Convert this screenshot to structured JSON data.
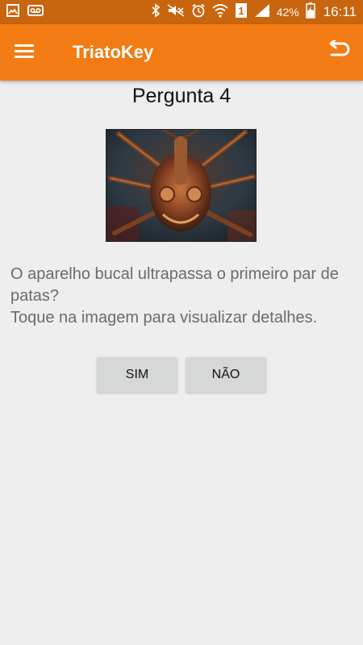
{
  "status_bar": {
    "battery_percent": "42%",
    "time": "16:11",
    "icons": [
      "gallery-icon",
      "voicemail-icon",
      "bluetooth-icon",
      "mute-icon",
      "alarm-icon",
      "wifi-icon",
      "sim1-icon",
      "signal-icon",
      "battery-charging-icon"
    ]
  },
  "app_bar": {
    "title": "TriatoKey",
    "menu_icon": "hamburger-menu-icon",
    "back_icon": "undo-return-icon"
  },
  "question": {
    "title": "Pergunta 4",
    "line1": "O aparelho bucal ultrapassa o primeiro par de patas?",
    "line2": "Toque na imagem para visualizar detalhes."
  },
  "answers": {
    "yes_label": "SIM",
    "no_label": "NÃO"
  },
  "colors": {
    "app_bar": "#f27b13",
    "status_bar": "#c9650f",
    "background": "#eeeeee",
    "button": "#d6d7d7"
  }
}
